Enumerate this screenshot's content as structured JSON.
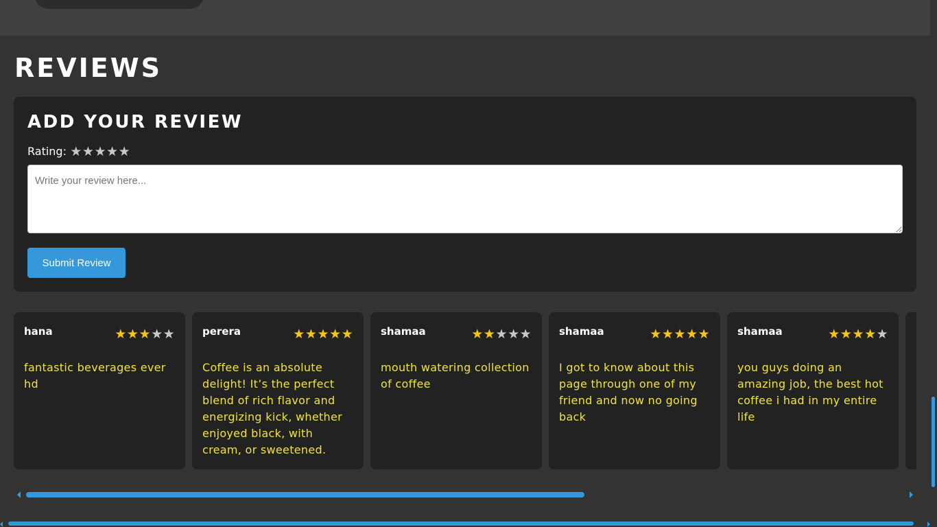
{
  "page": {
    "title": "REVIEWS",
    "background": "#333333"
  },
  "add_review": {
    "title": "ADD YOUR REVIEW",
    "rating_label": "Rating:",
    "rating_stars": [
      "★",
      "★",
      "★",
      "★",
      "★"
    ],
    "rating_value": 0,
    "textarea_placeholder": "Write your review here...",
    "textarea_value": "",
    "submit_label": "Submit Review",
    "accent": "#3498db"
  },
  "reviews": [
    {
      "name": "hana",
      "rating": 3,
      "text": "fantastic beverages ever hd"
    },
    {
      "name": "perera",
      "rating": 5,
      "text": "Coffee is an absolute delight! It’s the perfect blend of rich flavor and energizing kick, whether enjoyed black, with cream, or sweetened. Each cup of"
    },
    {
      "name": "shamaa",
      "rating": 2,
      "text": "mouth watering collection of coffee"
    },
    {
      "name": "shamaa",
      "rating": 5,
      "text": "I got to know about this page through one of my friend and now no going back"
    },
    {
      "name": "shamaa",
      "rating": 4,
      "text": "you guys doing an amazing job, the best hot coffee i had in my entire life"
    }
  ],
  "colors": {
    "star_filled": "#f5c518",
    "star_empty": "#c8c8c8",
    "review_text": "#f2e33b",
    "card_bg": "#222222"
  },
  "icons": {
    "star": "star-icon",
    "scroll_left": "chevron-left-icon",
    "scroll_right": "chevron-right-icon"
  }
}
